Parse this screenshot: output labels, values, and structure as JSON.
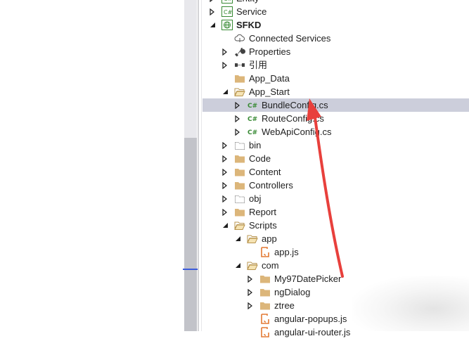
{
  "tree": [
    {
      "label": "Entity",
      "depth": 1,
      "expander": "collapsed",
      "icon": "csharp-project"
    },
    {
      "label": "Service",
      "depth": 1,
      "expander": "collapsed",
      "icon": "csharp-project"
    },
    {
      "label": "SFKD",
      "depth": 1,
      "expander": "expanded",
      "icon": "web-project",
      "bold": true
    },
    {
      "label": "Connected Services",
      "depth": 2,
      "expander": "none",
      "icon": "cloud"
    },
    {
      "label": "Properties",
      "depth": 2,
      "expander": "collapsed",
      "icon": "wrench"
    },
    {
      "label": "引用",
      "depth": 2,
      "expander": "collapsed",
      "icon": "references"
    },
    {
      "label": "App_Data",
      "depth": 2,
      "expander": "none",
      "icon": "folder"
    },
    {
      "label": "App_Start",
      "depth": 2,
      "expander": "expanded",
      "icon": "folder-open"
    },
    {
      "label": "BundleConfig.cs",
      "depth": 3,
      "expander": "collapsed",
      "icon": "csharp-file",
      "selected": true
    },
    {
      "label": "RouteConfig.cs",
      "depth": 3,
      "expander": "collapsed",
      "icon": "csharp-file"
    },
    {
      "label": "WebApiConfig.cs",
      "depth": 3,
      "expander": "collapsed",
      "icon": "csharp-file"
    },
    {
      "label": "bin",
      "depth": 2,
      "expander": "collapsed",
      "icon": "folder-dotted"
    },
    {
      "label": "Code",
      "depth": 2,
      "expander": "collapsed",
      "icon": "folder"
    },
    {
      "label": "Content",
      "depth": 2,
      "expander": "collapsed",
      "icon": "folder"
    },
    {
      "label": "Controllers",
      "depth": 2,
      "expander": "collapsed",
      "icon": "folder"
    },
    {
      "label": "obj",
      "depth": 2,
      "expander": "collapsed",
      "icon": "folder-dotted"
    },
    {
      "label": "Report",
      "depth": 2,
      "expander": "collapsed",
      "icon": "folder"
    },
    {
      "label": "Scripts",
      "depth": 2,
      "expander": "expanded",
      "icon": "folder-open"
    },
    {
      "label": "app",
      "depth": 3,
      "expander": "expanded",
      "icon": "folder-open"
    },
    {
      "label": "app.js",
      "depth": 4,
      "expander": "none",
      "icon": "js-file"
    },
    {
      "label": "com",
      "depth": 3,
      "expander": "expanded",
      "icon": "folder-open"
    },
    {
      "label": "My97DatePicker",
      "depth": 4,
      "expander": "collapsed",
      "icon": "folder"
    },
    {
      "label": "ngDialog",
      "depth": 4,
      "expander": "collapsed",
      "icon": "folder"
    },
    {
      "label": "ztree",
      "depth": 4,
      "expander": "collapsed",
      "icon": "folder"
    },
    {
      "label": "angular-popups.js",
      "depth": 4,
      "expander": "none",
      "icon": "js-file"
    },
    {
      "label": "angular-ui-router.js",
      "depth": 4,
      "expander": "none",
      "icon": "js-file"
    }
  ],
  "colors": {
    "selection": "#cccedb",
    "folder": "#dcb67a",
    "csharp": "#388a34",
    "js": "#e37933",
    "annotation_arrow": "#e8403c"
  }
}
